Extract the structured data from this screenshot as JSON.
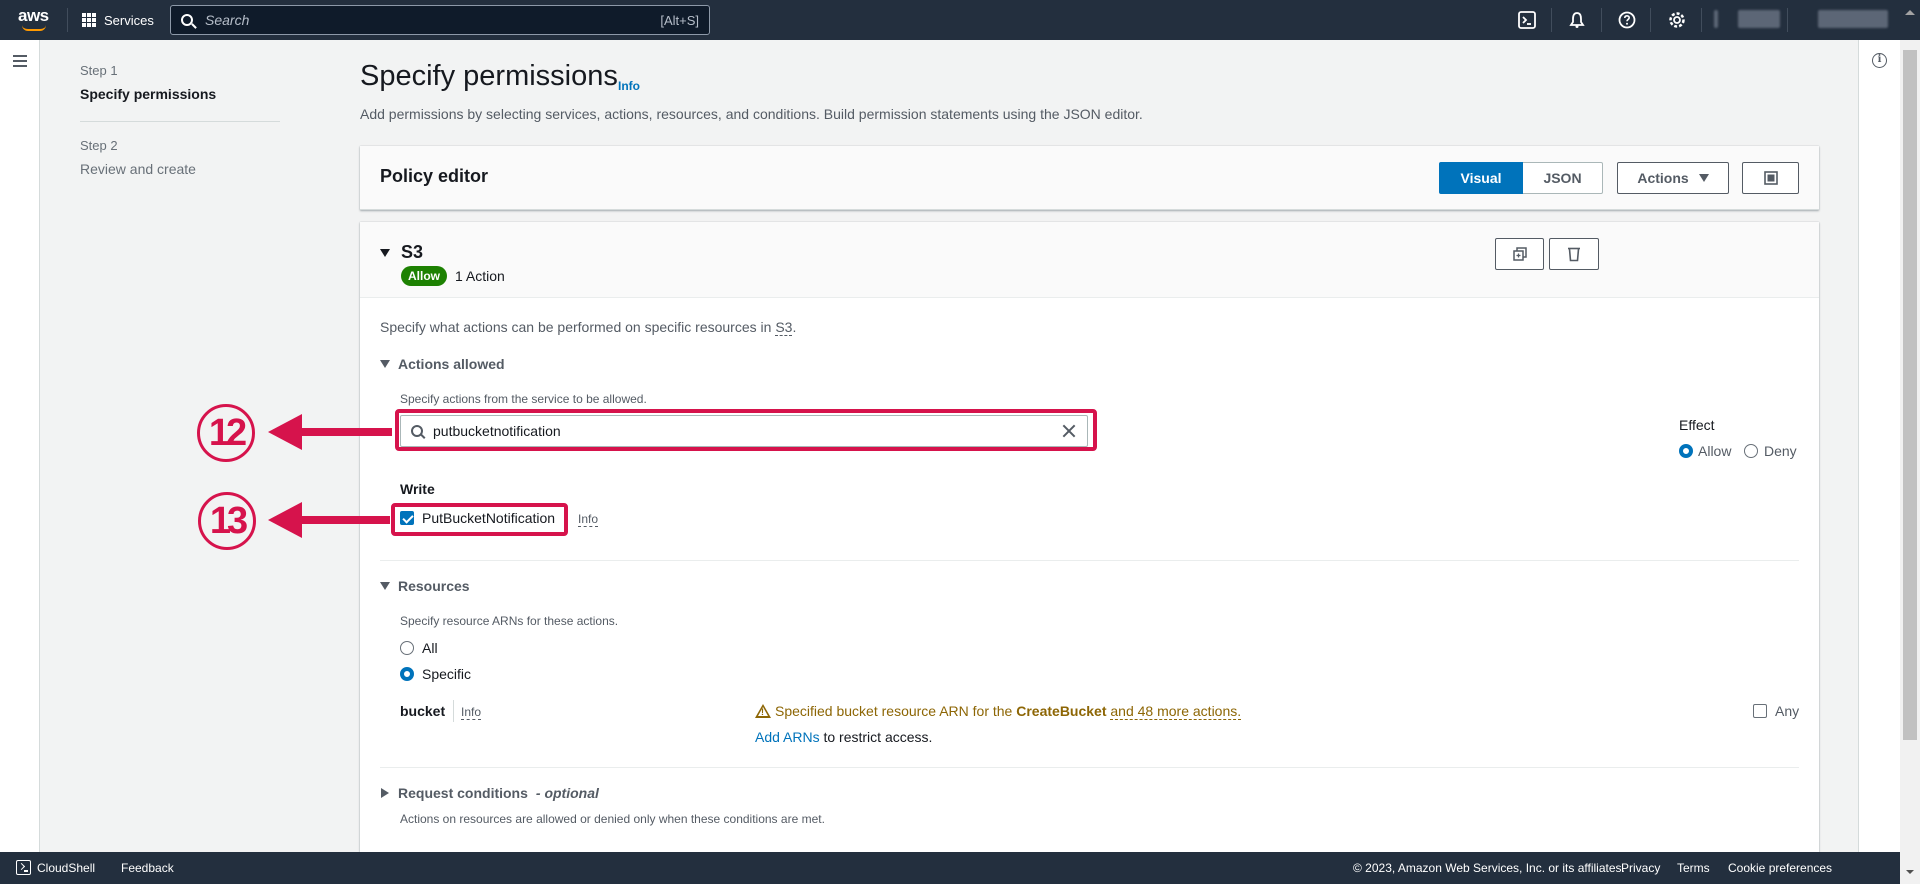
{
  "topnav": {
    "logo": "aws",
    "services_label": "Services",
    "search_placeholder": "Search",
    "search_shortcut": "[Alt+S]",
    "icons": [
      "cloudshell-icon",
      "bell-icon",
      "help-icon",
      "gear-icon"
    ]
  },
  "steps": [
    {
      "label": "Step 1",
      "title": "Specify permissions",
      "active": true
    },
    {
      "label": "Step 2",
      "title": "Review and create",
      "active": false
    }
  ],
  "header": {
    "title": "Specify permissions",
    "info": "Info",
    "description": "Add permissions by selecting services, actions, resources, and conditions. Build permission statements using the JSON editor."
  },
  "policy_editor": {
    "title": "Policy editor",
    "visual_label": "Visual",
    "json_label": "JSON",
    "actions_label": "Actions",
    "selected_mode": "Visual"
  },
  "statement": {
    "service": "S3",
    "effect_badge": "Allow",
    "action_count": "1 Action",
    "intro_prefix": "Specify what actions can be performed on specific resources in ",
    "intro_link": "S3",
    "intro_suffix": ".",
    "actions_allowed": {
      "title": "Actions allowed",
      "hint": "Specify actions from the service to be allowed.",
      "search_value": "putbucketnotification",
      "effect_label": "Effect",
      "effect_options": [
        "Allow",
        "Deny"
      ],
      "effect_selected": "Allow",
      "group_label": "Write",
      "action_name": "PutBucketNotification",
      "action_checked": true,
      "action_info": "Info"
    },
    "resources": {
      "title": "Resources",
      "hint": "Specify resource ARNs for these actions.",
      "options": [
        "All",
        "Specific"
      ],
      "selected": "Specific",
      "resource_type": "bucket",
      "resource_info": "Info",
      "warning_prefix": "Specified bucket resource ARN for the ",
      "warning_bold": "CreateBucket",
      "warning_link": "and 48 more actions.",
      "add_arns_link": "Add ARNs",
      "add_arns_suffix": " to restrict access.",
      "any_label": "Any",
      "any_checked": false
    },
    "request_conditions": {
      "title": "Request conditions",
      "optional": "- optional",
      "hint": "Actions on resources are allowed or denied only when these conditions are met."
    }
  },
  "annotations": [
    {
      "number": "12",
      "target": "action-search-input"
    },
    {
      "number": "13",
      "target": "put-bucket-notification-checkbox"
    }
  ],
  "footer": {
    "cloudshell": "CloudShell",
    "feedback": "Feedback",
    "copyright": "© 2023, Amazon Web Services, Inc. or its affiliates.",
    "privacy": "Privacy",
    "terms": "Terms",
    "cookie": "Cookie preferences"
  },
  "colors": {
    "nav_bg": "#232f3e",
    "primary": "#0073bb",
    "allow_green": "#1d8102",
    "warning": "#8d6605",
    "annotation": "#d6134c"
  }
}
